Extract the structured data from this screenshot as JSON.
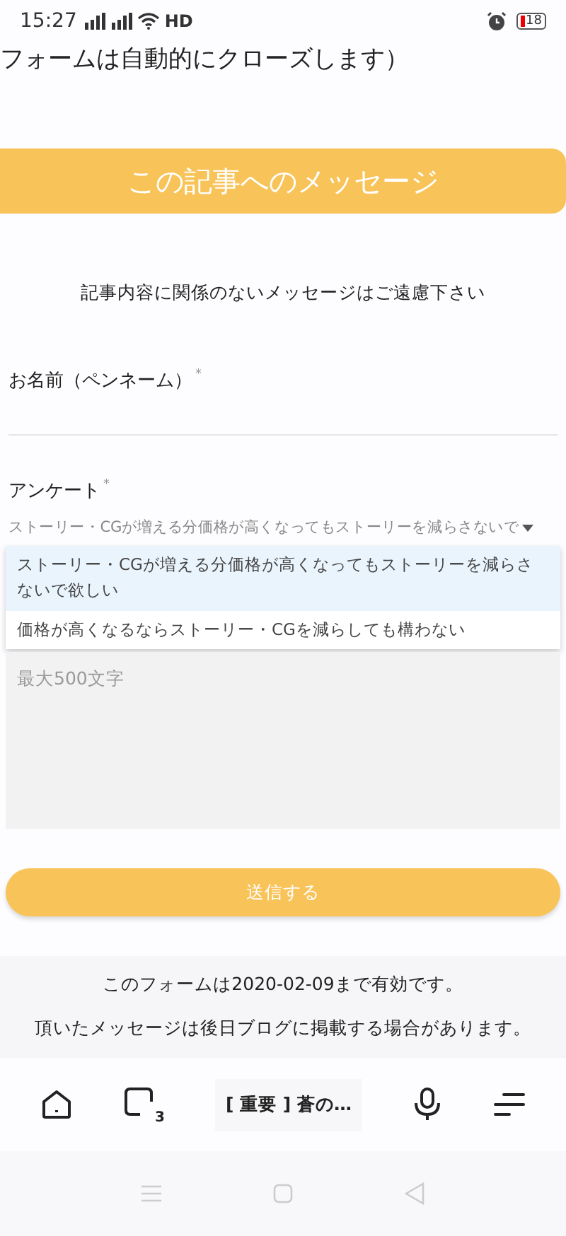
{
  "status_bar": {
    "time": "15:27",
    "network": "HD",
    "battery": "18"
  },
  "cut_text": "フォームは自動的にクローズします）",
  "header": {
    "title": "この記事へのメッセージ"
  },
  "notice": "記事内容に関係のないメッセージはご遠慮下さい",
  "form": {
    "name_label": "お名前（ペンネーム）",
    "name_mark": "*",
    "survey_label": "アンケート",
    "survey_mark": "*",
    "survey_value": "ストーリー・CGが増える分価格が高くなってもストーリーを減らさないで",
    "options": [
      {
        "label": "ストーリー・CGが増える分価格が高くなってもストーリーを減らさないで欲しい",
        "selected": true
      },
      {
        "label": "価格が高くなるならストーリー・CGを減らしても構わない",
        "selected": false
      }
    ],
    "message_placeholder": "最大500文字",
    "submit": "送信する"
  },
  "footer": [
    "このフォームは2020-02-09まで有効です。",
    "頂いたメッセージは後日ブログに掲載する場合があります。"
  ],
  "browser_bar": {
    "tab_count": "3",
    "tab_title": "[ 重要 ] 蒼の…"
  }
}
